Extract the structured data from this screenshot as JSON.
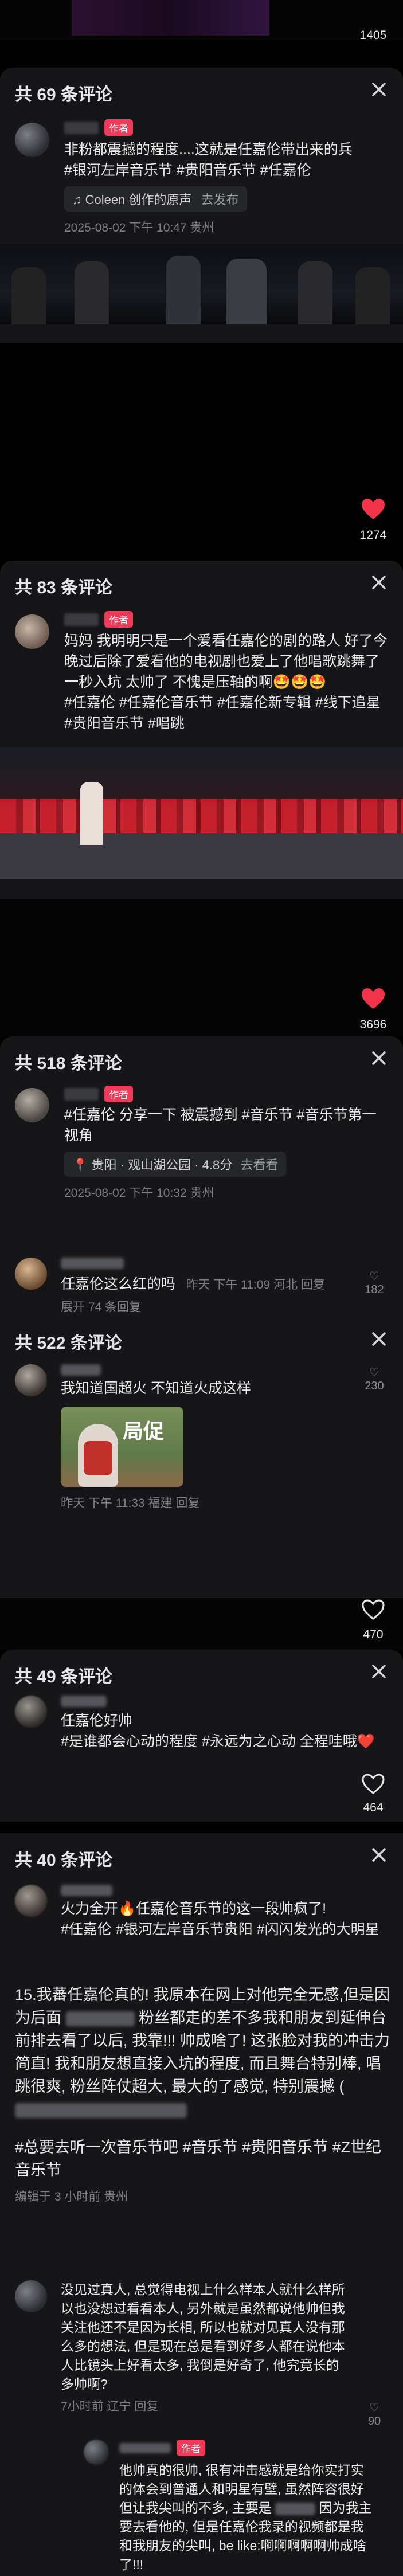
{
  "video1": {
    "likes": "1405"
  },
  "panel1": {
    "title": "共 69 条评论",
    "author_badge": "作者",
    "text": "非粉都震撼的程度....这就是任嘉伦带出来的兵",
    "tags": "#银河左岸音乐节 #贵阳音乐节 #任嘉伦",
    "music": "Coleen 创作的原声",
    "music_suffix": "去发布",
    "timestamp": "2025-08-02 下午 10:47 贵州"
  },
  "video2": {
    "likes": "1274"
  },
  "panel2": {
    "title": "共 83 条评论",
    "author_badge": "作者",
    "text": "妈妈 我明明只是一个爱看任嘉伦的剧的路人 好了今晚过后除了爱看他的电视剧也爱上了他唱歌跳舞了 一秒入坑 太帅了 不愧是压轴的啊🤩🤩🤩",
    "tags": "#任嘉伦 #任嘉伦音乐节 #任嘉伦新专辑 #线下追星 #贵阳音乐节 #唱跳"
  },
  "video3": {
    "likes": "3696"
  },
  "panel3": {
    "title": "共 518 条评论",
    "author_badge": "作者",
    "text": "#任嘉伦 分享一下 被震撼到 #音乐节 #音乐节第一视角",
    "location": "贵阳 · 观山湖公园 · 4.8分",
    "location_action": "去看看",
    "timestamp": "2025-08-02 下午 10:32 贵州",
    "reply_text": "任嘉伦这么红的吗",
    "reply_meta": "昨天 下午 11:09 河北 回复",
    "reply_likes": "182",
    "expand": "展开 74 条回复"
  },
  "panel4": {
    "title": "共 522 条评论",
    "text": "我知道国超火 不知道火成这样",
    "sticker_text": "局促",
    "meta": "昨天 下午 11:33 福建 回复",
    "likes": "230"
  },
  "video5": {
    "likes": "470"
  },
  "panel5": {
    "title": "共 49 条评论",
    "text": "任嘉伦好帅",
    "tags": "#是谁都会心动的程度 #永远为之心动 全程哇哦❤️",
    "likes": "464"
  },
  "panel6": {
    "title": "共 40 条评论",
    "text1": "火力全开🔥任嘉伦音乐节的这一段帅疯了!",
    "tags1": "#任嘉伦 #银河左岸音乐节贵阳 #闪闪发光的大明星",
    "text2": "15.我蕃任嘉伦真的! 我原本在网上对他完全无感,但是因为后面",
    "text3": "粉丝都走的差不多我和朋友到延伸台前排去看了以后, 我靠!!! 帅成啥了! 这张脸对我的冲击力简直! 我和朋友想直接入坑的程度, 而且舞台特别棒, 唱跳很爽, 粉丝阵仗超大, 最大的了感觉, 特别震撼 (",
    "tags2": "#总要去听一次音乐节吧 #音乐节 #贵阳音乐节 #Z世纪音乐节",
    "edited": "编辑于 3 小时前 贵州",
    "c1_text": "没见过真人, 总觉得电视上什么样本人就什么样所以也没想过看看本人, 另外就是虽然都说他帅但我关注他还不是因为长相, 所以也就对见真人没有那么多的想法, 但是现在总是看到好多人都在说他本人比镜头上好看太多, 我倒是好奇了, 他究竟长的多帅啊?",
    "c1_meta": "7小时前 辽宁 回复",
    "c1_likes": "90",
    "c2_text": "他帅真的很帅, 很有冲击感就是给你实打实的体会到普通人和明星有壁, 虽然阵容很好但让我尖叫的不多, 主要是",
    "c2_text_b": "因为我主要去看他的, 但是任嘉伦我录的视频都是我和我朋友的尖叫, be like:啊啊啊啊啊帅成啥了!!!"
  },
  "colors": {
    "accent": "#f03a5a",
    "heart": "#f2344a"
  }
}
